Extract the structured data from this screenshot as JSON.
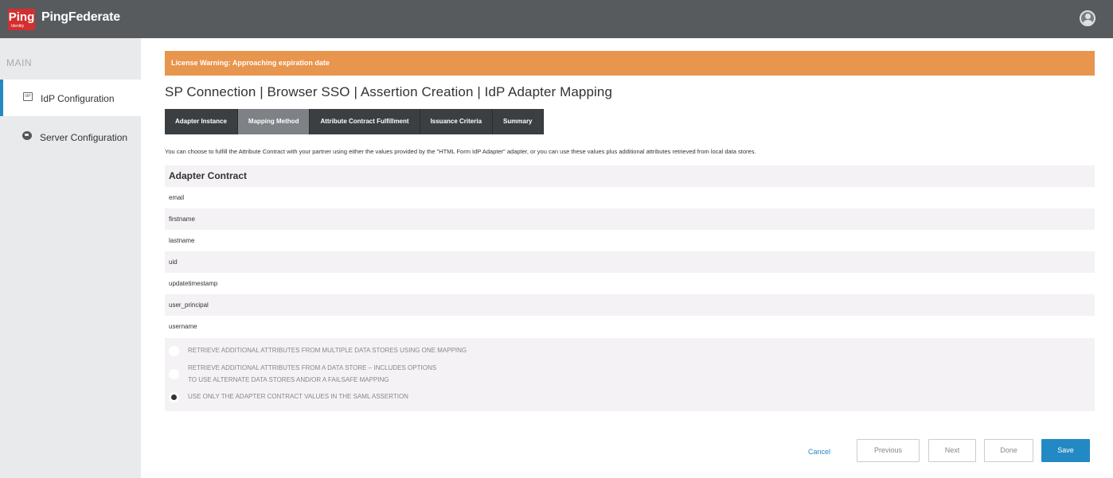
{
  "header": {
    "logo_text": "Ping",
    "logo_sub": "Identity",
    "product_name": "PingFederate",
    "logo_color": "#d32f2f"
  },
  "sidebar": {
    "section_label": "MAIN",
    "items": [
      {
        "label": "IdP Configuration",
        "icon": "idp-icon",
        "icon_text": "IdP",
        "active": true
      },
      {
        "label": "Server Configuration",
        "icon": "server-icon",
        "active": false
      }
    ]
  },
  "warning": {
    "text": "License Warning: Approaching expiration date",
    "color": "#e8954d"
  },
  "page": {
    "title": "SP Connection | Browser SSO | Assertion Creation | IdP Adapter Mapping"
  },
  "tabs": [
    {
      "label": "Adapter Instance",
      "active": false
    },
    {
      "label": "Mapping Method",
      "active": true
    },
    {
      "label": "Attribute Contract Fulfillment",
      "active": false
    },
    {
      "label": "Issuance Criteria",
      "active": false
    },
    {
      "label": "Summary",
      "active": false
    }
  ],
  "description": "You can choose to fulfill the Attribute Contract with your partner using either the values provided by the \"HTML Form IdP Adapter\" adapter, or you can use these values plus additional attributes retrieved from local data stores.",
  "contract": {
    "header": "Adapter Contract",
    "rows": [
      "email",
      "firstname",
      "lastname",
      "uid",
      "updatetimestamp",
      "user_principal",
      "username"
    ]
  },
  "options": [
    {
      "line1": "RETRIEVE ADDITIONAL ATTRIBUTES FROM MULTIPLE DATA STORES USING ONE MAPPING",
      "line2": "",
      "checked": false
    },
    {
      "line1": "RETRIEVE ADDITIONAL ATTRIBUTES FROM A DATA STORE – INCLUDES OPTIONS",
      "line2": "TO USE ALTERNATE DATA STORES AND/OR A FAILSAFE MAPPING",
      "checked": false
    },
    {
      "line1": "USE ONLY THE ADAPTER CONTRACT VALUES IN THE SAML ASSERTION",
      "line2": "",
      "checked": true
    }
  ],
  "buttons": {
    "cancel": "Cancel",
    "previous": "Previous",
    "next": "Next",
    "done": "Done",
    "save": "Save",
    "accent": "#2389c4"
  }
}
